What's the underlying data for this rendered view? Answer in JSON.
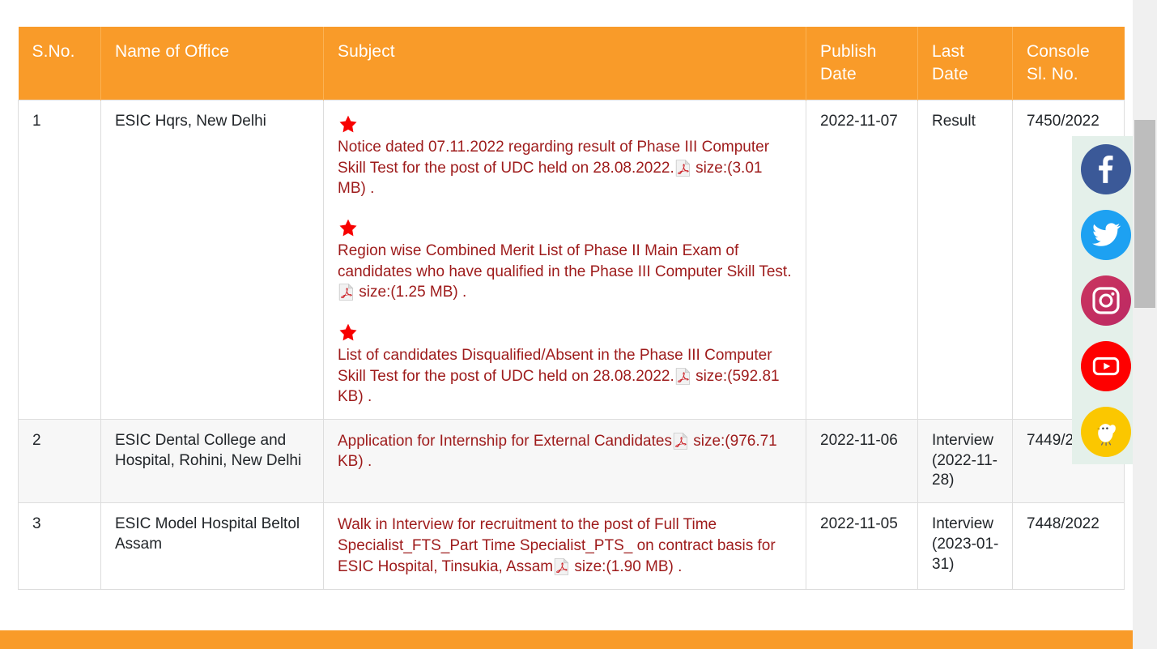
{
  "table": {
    "headers": [
      {
        "key": "sno",
        "label": "S.No."
      },
      {
        "key": "office",
        "label": "Name of Office"
      },
      {
        "key": "subject",
        "label": "Subject"
      },
      {
        "key": "publish",
        "label": "Publish Date"
      },
      {
        "key": "last",
        "label": "Last Date"
      },
      {
        "key": "console",
        "label": "Console Sl. No."
      }
    ],
    "rows": [
      {
        "sno": "1",
        "office": "ESIC Hqrs, New Delhi",
        "subject_blocks": [
          {
            "has_star": true,
            "star_icon": "red-star-icon",
            "text": "Notice dated 07.11.2022 regarding result of Phase III Computer Skill Test for the post of UDC held on 28.08.2022.",
            "file_icon": "pdf-icon",
            "size": "size:(3.01 MB) ."
          },
          {
            "has_star": true,
            "star_icon": "red-star-icon",
            "text": "Region wise Combined Merit List of Phase II Main Exam of candidates who have qualified in the Phase III Computer Skill Test.",
            "file_icon": "pdf-icon",
            "size": "size:(1.25 MB) ."
          },
          {
            "has_star": true,
            "star_icon": "red-star-icon",
            "text": "List of candidates Disqualified/Absent in the Phase III Computer Skill Test for the post of UDC held on 28.08.2022.",
            "file_icon": "pdf-icon",
            "size": "size:(592.81 KB) ."
          }
        ],
        "publish": "2022-11-07",
        "last": "Result",
        "console": "7450/2022",
        "shaded": false
      },
      {
        "sno": "2",
        "office": "ESIC Dental College and Hospital, Rohini, New Delhi",
        "subject_blocks": [
          {
            "has_star": false,
            "star_icon": "",
            "text": "Application for Internship for External Candidates",
            "file_icon": "pdf-icon",
            "size": "size:(976.71 KB) ."
          }
        ],
        "publish": "2022-11-06",
        "last": "Interview (2022-11-28)",
        "console": "7449/2022",
        "shaded": true
      },
      {
        "sno": "3",
        "office": "ESIC Model Hospital Beltol Assam",
        "subject_blocks": [
          {
            "has_star": false,
            "star_icon": "",
            "text": "Walk in Interview for recruitment to the post of Full Time Specialist_FTS_Part Time Specialist_PTS_ on contract basis for ESIC Hospital, Tinsukia, Assam",
            "file_icon": "pdf-icon",
            "size": "size:(1.90 MB) ."
          }
        ],
        "publish": "2022-11-05",
        "last": "Interview (2023-01-31)",
        "console": "7448/2022",
        "shaded": false
      }
    ]
  },
  "social_rail": {
    "items": [
      {
        "name": "facebook",
        "icon": "facebook-icon",
        "color": "#3b5998"
      },
      {
        "name": "twitter",
        "icon": "twitter-icon",
        "color": "#1da1f2"
      },
      {
        "name": "instagram",
        "icon": "instagram-icon",
        "color": "#c42e60"
      },
      {
        "name": "youtube",
        "icon": "youtube-icon",
        "color": "#fe0000"
      },
      {
        "name": "koo",
        "icon": "koo-bird-icon",
        "color": "#fbc700"
      }
    ]
  },
  "colors": {
    "header_orange": "#f99b29",
    "link_maroon": "#9e1b1b",
    "star_red": "#f70000",
    "row_shade": "#f7f7f7",
    "border": "#dddddd",
    "scrollbar_thumb": "#bdbdbd",
    "scrollbar_track": "#f0f0f0"
  }
}
